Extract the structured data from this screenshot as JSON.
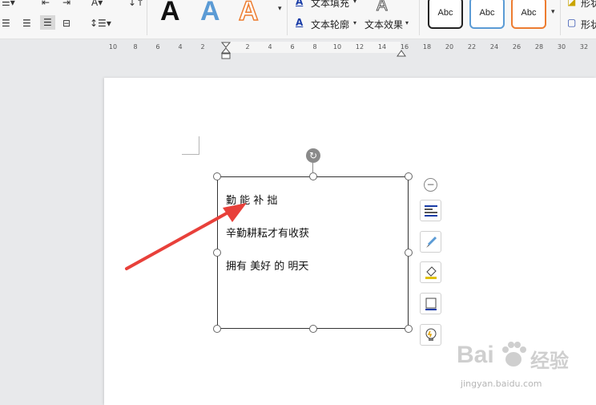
{
  "ribbon": {
    "style_letters": [
      "A",
      "A",
      "A"
    ],
    "text_fill_label": "文本填充",
    "text_outline_label": "文本轮廓",
    "text_effect_label": "文本效果",
    "shape_styles": [
      "Abc",
      "Abc",
      "Abc"
    ],
    "shape_fill_label": "形状",
    "shape_outline_label": "形状",
    "colors": {
      "letter_black": "#111111",
      "letter_blue": "#5b9bd5",
      "letter_orange": "#ed7d31",
      "style_black": "#222222",
      "style_blue": "#5b9bd5",
      "style_orange": "#ed7d31"
    }
  },
  "ruler": {
    "labels": [
      "10",
      "8",
      "6",
      "4",
      "2",
      "2",
      "4",
      "6",
      "8",
      "10",
      "12",
      "14",
      "16",
      "18",
      "20",
      "22",
      "24",
      "26",
      "28",
      "30",
      "32"
    ]
  },
  "textbox": {
    "lines": [
      "勤 能 补 拙",
      "辛勤耕耘才有收获",
      "拥有 美好 的 明天"
    ]
  },
  "side_toolbar": {
    "icons": [
      "layout-icon",
      "brush-icon",
      "fill-icon",
      "border-icon",
      "lightbulb-icon"
    ]
  },
  "watermark": {
    "brand": "Bai",
    "brand_suffix": "经验",
    "url": "jingyan.baidu.com"
  }
}
